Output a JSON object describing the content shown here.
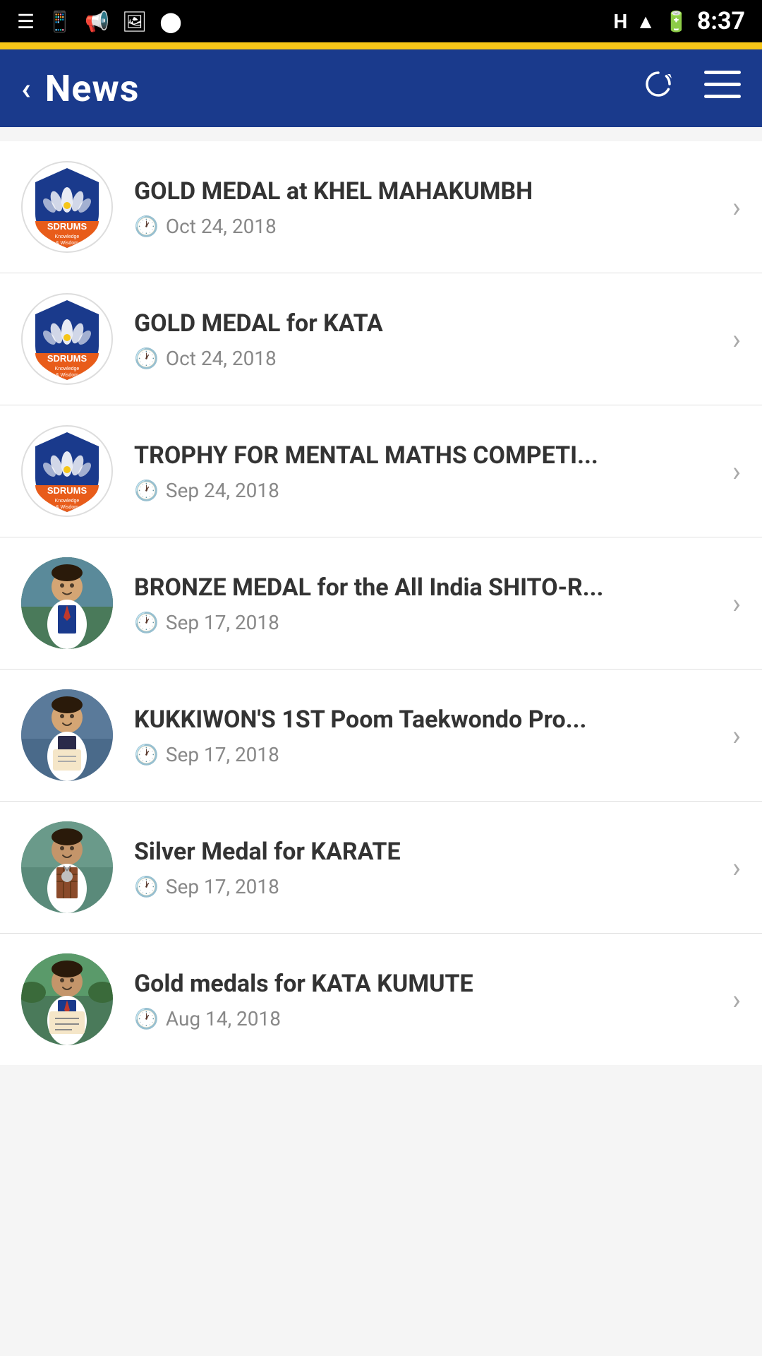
{
  "statusBar": {
    "time": "8:37",
    "icons": [
      "chat",
      "whatsapp",
      "megaphone",
      "image",
      "camera"
    ]
  },
  "header": {
    "back_label": "‹",
    "title": "News",
    "refresh_icon": "refresh",
    "menu_icon": "menu"
  },
  "accentColor": "#f5c518",
  "newsItems": [
    {
      "id": 1,
      "title": "GOLD MEDAL at KHEL MAHAKUMBH",
      "date": "Oct 24, 2018",
      "thumb_type": "logo"
    },
    {
      "id": 2,
      "title": "GOLD MEDAL for KATA",
      "date": "Oct 24, 2018",
      "thumb_type": "logo"
    },
    {
      "id": 3,
      "title": "TROPHY FOR MENTAL MATHS COMPETI...",
      "date": "Sep 24, 2018",
      "thumb_type": "logo"
    },
    {
      "id": 4,
      "title": "BRONZE MEDAL for the All India SHITO-R...",
      "date": "Sep 17, 2018",
      "thumb_type": "person",
      "bg_color": "#5a8a6a"
    },
    {
      "id": 5,
      "title": "KUKKIWON'S 1ST Poom Taekwondo Pro...",
      "date": "Sep 17, 2018",
      "thumb_type": "person",
      "bg_color": "#4a7a9b"
    },
    {
      "id": 6,
      "title": "Silver Medal for KARATE",
      "date": "Sep 17, 2018",
      "thumb_type": "person",
      "bg_color": "#6a9a7a"
    },
    {
      "id": 7,
      "title": "Gold medals for KATA KUMUTE",
      "date": "Aug 14, 2018",
      "thumb_type": "person",
      "bg_color": "#5a8a7a"
    }
  ]
}
